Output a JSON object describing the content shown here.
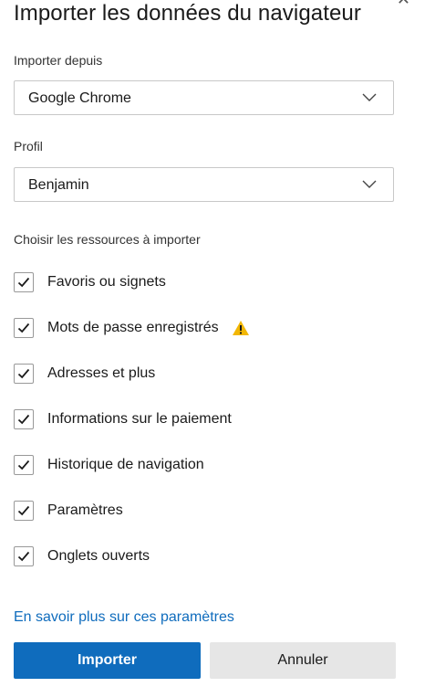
{
  "dialog": {
    "title": "Importer les données du navigateur"
  },
  "import_from": {
    "label": "Importer depuis",
    "value": "Google Chrome"
  },
  "profile": {
    "label": "Profil",
    "value": "Benjamin"
  },
  "resources": {
    "label": "Choisir les ressources à importer",
    "items": [
      {
        "label": "Favoris ou signets",
        "checked": true
      },
      {
        "label": "Mots de passe enregistrés",
        "checked": true,
        "warning": true
      },
      {
        "label": "Adresses et plus",
        "checked": true
      },
      {
        "label": "Informations sur le paiement",
        "checked": true
      },
      {
        "label": "Historique de navigation",
        "checked": true
      },
      {
        "label": "Paramètres",
        "checked": true
      },
      {
        "label": "Onglets ouverts",
        "checked": true
      }
    ]
  },
  "learn_more": "En savoir plus sur ces paramètres",
  "buttons": {
    "import_label": "Importer",
    "cancel_label": "Annuler"
  },
  "colors": {
    "accent": "#0f6cbd",
    "warning": "#f2b705"
  },
  "icons": {
    "close": "close-icon",
    "chevron": "chevron-down-icon",
    "check": "checkmark-icon",
    "warning": "warning-icon"
  }
}
